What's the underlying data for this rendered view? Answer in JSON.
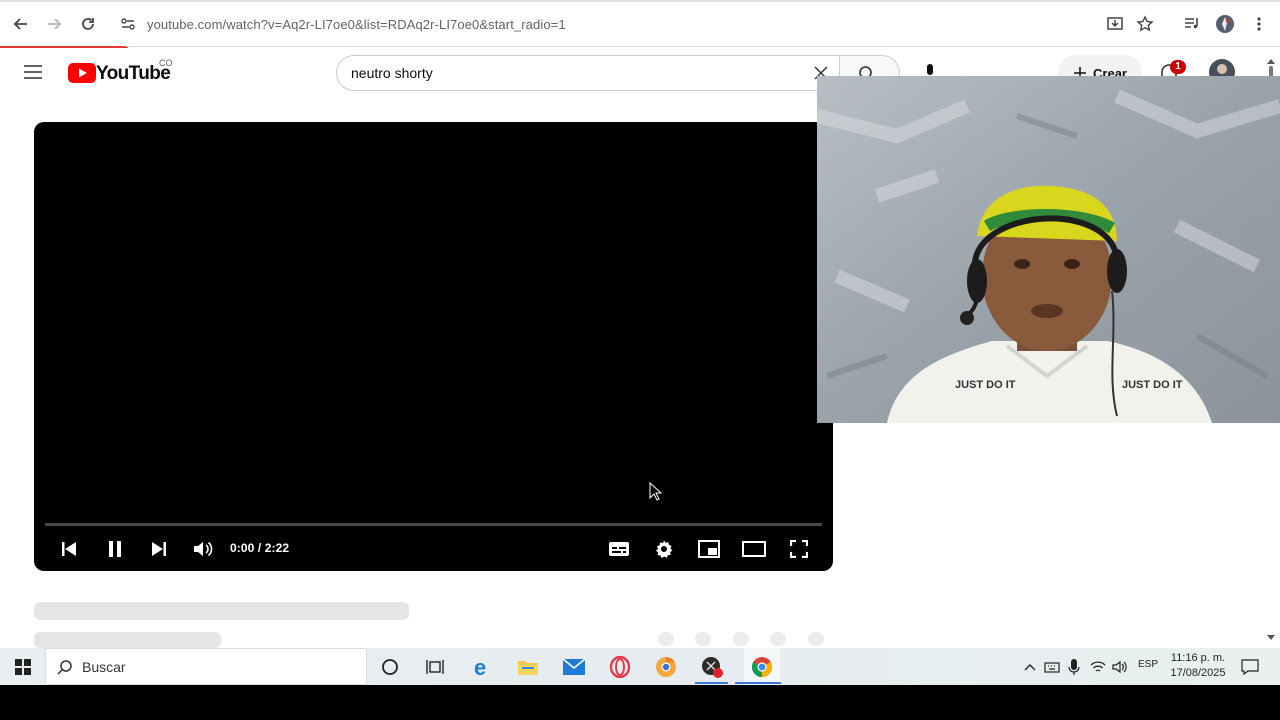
{
  "browser": {
    "url": "youtube.com/watch?v=Aq2r-LI7oe0&list=RDAq2r-LI7oe0&start_radio=1",
    "load_progress": 0.1
  },
  "youtube": {
    "logo_text": "YouTube",
    "country_code": "CO",
    "search_value": "neutro shorty",
    "create_label": "Crear",
    "notification_count": "1",
    "brand_color": "#ff0000"
  },
  "player": {
    "time": "0:00 / 2:22",
    "state": "playing",
    "progress": 0
  },
  "taskbar": {
    "search_label": "Buscar",
    "language": "ESP",
    "time": "11:16 p. m.",
    "date": "17/08/2025"
  }
}
